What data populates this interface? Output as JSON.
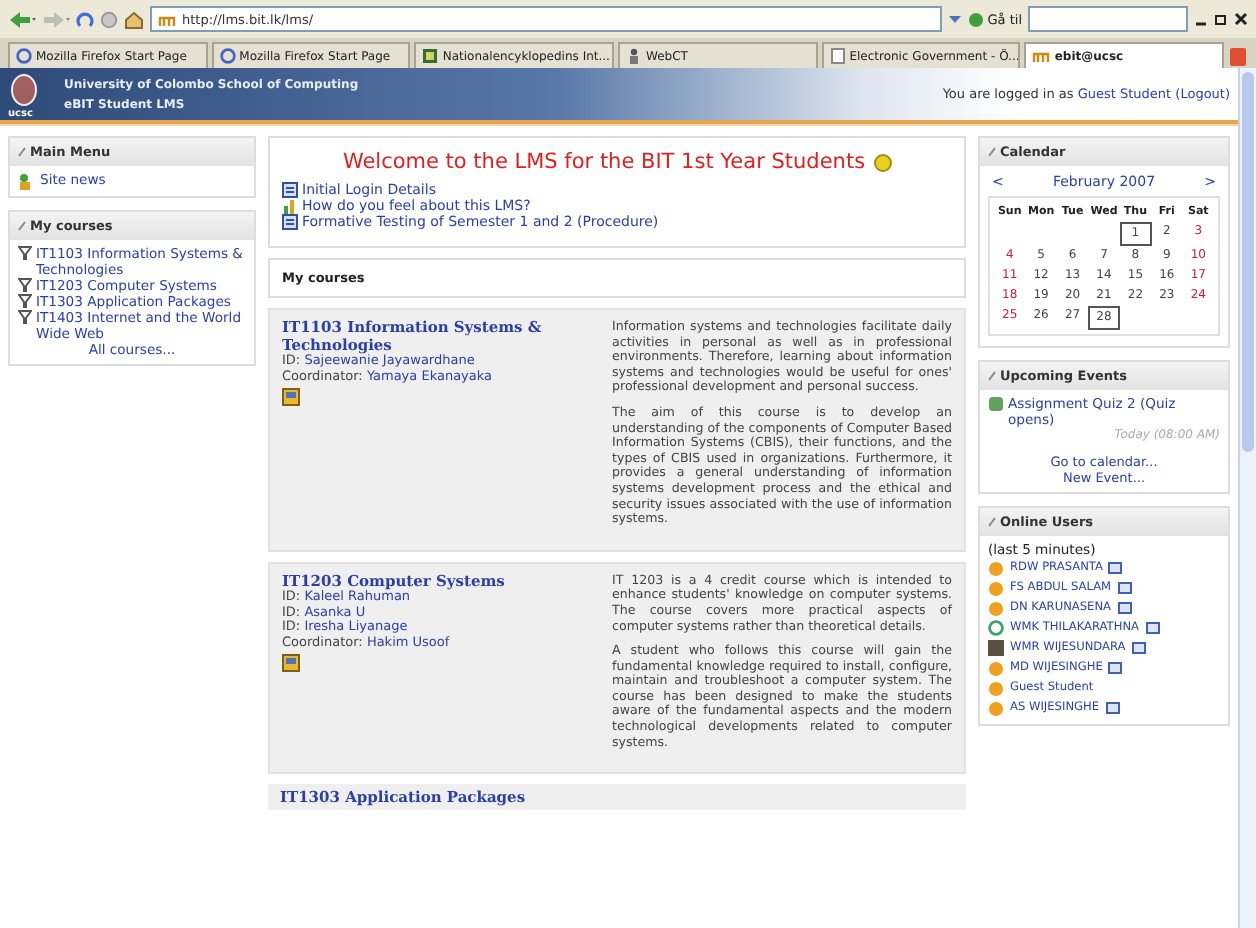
{
  "browser": {
    "url": "http://lms.bit.lk/lms/",
    "go_label": "Gå til",
    "tabs": [
      {
        "label": "Mozilla Firefox Start Page",
        "kind": "google",
        "selected": false
      },
      {
        "label": "Mozilla Firefox Start Page",
        "kind": "google",
        "selected": false
      },
      {
        "label": "Nationalencyklopedins Int...",
        "kind": "encyclopedia",
        "selected": false
      },
      {
        "label": "WebCT",
        "kind": "webct",
        "selected": false
      },
      {
        "label": "Electronic Government - Ö...",
        "kind": "page",
        "selected": false
      },
      {
        "label": "ebit@ucsc",
        "kind": "moodle",
        "selected": true
      }
    ]
  },
  "header": {
    "institution": "University of Colombo School of Computing",
    "site": "eBIT Student LMS",
    "logo_text": "ucsc",
    "login_prefix": "You are logged in as",
    "user": "Guest Student",
    "logout": "(Logout)"
  },
  "main_menu": {
    "title": "Main Menu",
    "items": [
      "Site news"
    ]
  },
  "my_courses_block": {
    "title": "My courses",
    "items": [
      "IT1103 Information Systems & Technologies",
      "IT1203 Computer Systems",
      "IT1303 Application Packages",
      "IT1403 Internet and the World Wide Web"
    ],
    "all_link": "All courses..."
  },
  "welcome": {
    "title": "Welcome to the LMS for the BIT 1st Year Students",
    "links": [
      {
        "label": "Initial Login Details",
        "kind": "document"
      },
      {
        "label": "How do you feel about this LMS?",
        "kind": "choice"
      },
      {
        "label": "Formative Testing of Semester 1 and 2 (Procedure)",
        "kind": "document"
      }
    ]
  },
  "courses": {
    "title": "My courses",
    "items": [
      {
        "name": "IT1103 Information Systems & Technologies",
        "staff": [
          {
            "role": "ID:",
            "name": "Sajeewanie Jayawardhane"
          },
          {
            "role": "Coordinator:",
            "name": "Yamaya Ekanayaka"
          }
        ],
        "paragraphs": [
          "Information systems and technologies facilitate daily activities in personal as well as in professional environments. Therefore, learning about information systems and technologies would be useful for ones' professional development and personal success.",
          "The aim of this course is to develop an understanding of the components of Computer Based Information Systems (CBIS), their functions, and the types of CBIS used in organizations. Furthermore, it provides a general understanding of information systems development process and the ethical and security issues associated with the use of information systems."
        ]
      },
      {
        "name": "IT1203 Computer Systems",
        "staff": [
          {
            "role": "ID:",
            "name": "Kaleel Rahuman"
          },
          {
            "role": "ID:",
            "name": "Asanka U"
          },
          {
            "role": "ID:",
            "name": "Iresha Liyanage"
          },
          {
            "role": "Coordinator:",
            "name": "Hakim Usoof"
          }
        ],
        "paragraphs": [
          "IT 1203 is a 4 credit course which is intended to enhance students' knowledge on computer systems. The course covers more practical aspects of computer systems rather than theoretical details.",
          "A student who follows this course will gain the fundamental knowledge required to install, configure, maintain and troubleshoot a computer system. The course has been designed to make the students aware of the fundamental aspects and the modern technological developments related to computer systems."
        ]
      }
    ],
    "next": "IT1303 Application Packages"
  },
  "calendar": {
    "title": "Calendar",
    "prev": "<",
    "month": "February 2007",
    "next": ">",
    "weekdays": [
      "Sun",
      "Mon",
      "Tue",
      "Wed",
      "Thu",
      "Fri",
      "Sat"
    ],
    "weeks": [
      [
        {
          "day": "1",
          "highlighted": true
        },
        {
          "day": "2",
          "highlighted": false
        },
        {
          "day": "3",
          "highlighted": false
        }
      ],
      [
        {
          "day": "4",
          "highlighted": false
        },
        {
          "day": "5",
          "highlighted": false
        },
        {
          "day": "6",
          "highlighted": false
        },
        {
          "day": "7",
          "highlighted": false
        },
        {
          "day": "8",
          "highlighted": false
        },
        {
          "day": "9",
          "highlighted": false
        },
        {
          "day": "10",
          "highlighted": false
        }
      ],
      [
        {
          "day": "11",
          "highlighted": false
        },
        {
          "day": "12",
          "highlighted": false
        },
        {
          "day": "13",
          "highlighted": false
        },
        {
          "day": "14",
          "highlighted": false
        },
        {
          "day": "15",
          "highlighted": false
        },
        {
          "day": "16",
          "highlighted": false
        },
        {
          "day": "17",
          "highlighted": false
        }
      ],
      [
        {
          "day": "18",
          "highlighted": false
        },
        {
          "day": "19",
          "highlighted": false
        },
        {
          "day": "20",
          "highlighted": false
        },
        {
          "day": "21",
          "highlighted": false
        },
        {
          "day": "22",
          "highlighted": false
        },
        {
          "day": "23",
          "highlighted": false
        },
        {
          "day": "24",
          "highlighted": false
        }
      ],
      [
        {
          "day": "25",
          "highlighted": false
        },
        {
          "day": "26",
          "highlighted": false
        },
        {
          "day": "27",
          "highlighted": false
        },
        {
          "day": "28",
          "highlighted": true
        }
      ]
    ]
  },
  "upcoming": {
    "title": "Upcoming Events",
    "events": [
      {
        "label": "Assignment Quiz 2 (Quiz opens)",
        "time": "Today (08:00 AM)"
      }
    ],
    "links": [
      "Go to calendar...",
      "New Event..."
    ]
  },
  "online": {
    "title": "Online Users",
    "period": "(last 5 minutes)",
    "users": [
      {
        "name": "RDW PRASANTA",
        "kind": "default",
        "messaging": true
      },
      {
        "name": "FS ABDUL SALAM",
        "kind": "default",
        "messaging": true
      },
      {
        "name": "DN KARUNASENA",
        "kind": "default",
        "messaging": true
      },
      {
        "name": "WMK THILAKARATHNA",
        "kind": "logo",
        "messaging": true
      },
      {
        "name": "WMR WIJESUNDARA",
        "kind": "photo",
        "messaging": true
      },
      {
        "name": "MD WIJESINGHE",
        "kind": "default",
        "messaging": true
      },
      {
        "name": "Guest Student",
        "kind": "default",
        "messaging": false
      },
      {
        "name": "AS WIJESINGHE",
        "kind": "default",
        "messaging": true
      }
    ]
  }
}
